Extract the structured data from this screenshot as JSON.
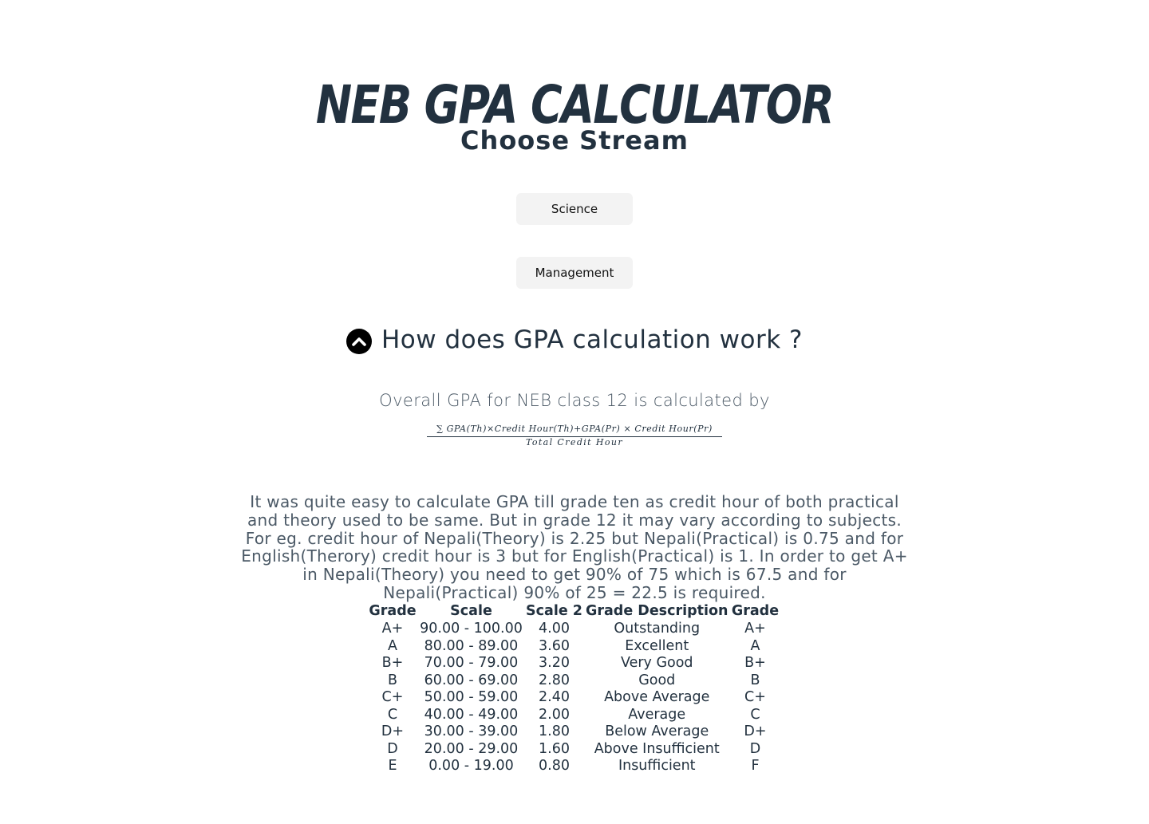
{
  "header": {
    "title": "NEB GPA CALCULATOR",
    "subtitle": "Choose Stream"
  },
  "streams": {
    "science_label": "Science",
    "management_label": "Management"
  },
  "info": {
    "heading": "How does GPA calculation work ?",
    "toggle_icon": "chevron-up-circle-icon",
    "intro": "Overall GPA for NEB class 12 is calculated by",
    "formula_numerator": "∑ GPA(Th)×Credit  Hour(Th)+GPA(Pr)  ×  Credit  Hour(Pr)",
    "formula_denominator": "Total  Credit  Hour",
    "explanation": "It was quite easy to calculate GPA till grade ten as credit hour of both practical and theory used to be same. But in grade 12 it may vary according to subjects. For eg. credit hour of Nepali(Theory) is 2.25 but Nepali(Practical) is 0.75 and for English(Therory) credit hour is 3 but for English(Practical) is 1. In order to get A+ in Nepali(Theory) you need to get 90% of 75 which is 67.5 and for Nepali(Practical) 90% of 25 = 22.5 is required."
  },
  "grade_table": {
    "headers": [
      "Grade",
      "Scale",
      "Scale 2",
      "Grade Description",
      "Grade"
    ],
    "rows": [
      [
        "A+",
        "90.00 - 100.00",
        "4.00",
        "Outstanding",
        "A+"
      ],
      [
        "A",
        "80.00 - 89.00",
        "3.60",
        "Excellent",
        "A"
      ],
      [
        "B+",
        "70.00 - 79.00",
        "3.20",
        "Very Good",
        "B+"
      ],
      [
        "B",
        "60.00 - 69.00",
        "2.80",
        "Good",
        "B"
      ],
      [
        "C+",
        "50.00 - 59.00",
        "2.40",
        "Above Average",
        "C+"
      ],
      [
        "C",
        "40.00 - 49.00",
        "2.00",
        "Average",
        "C"
      ],
      [
        "D+",
        "30.00 - 39.00",
        "1.80",
        "Below Average",
        "D+"
      ],
      [
        "D",
        "20.00 - 29.00",
        "1.60",
        "Above Insufficient",
        "D"
      ],
      [
        "E",
        "0.00 - 19.00",
        "0.80",
        "Insufficient",
        "F"
      ]
    ]
  },
  "colors": {
    "text_primary": "#22313f",
    "text_muted": "#4b5966",
    "button_bg": "#f3f3f3",
    "icon_bg": "#000000"
  }
}
